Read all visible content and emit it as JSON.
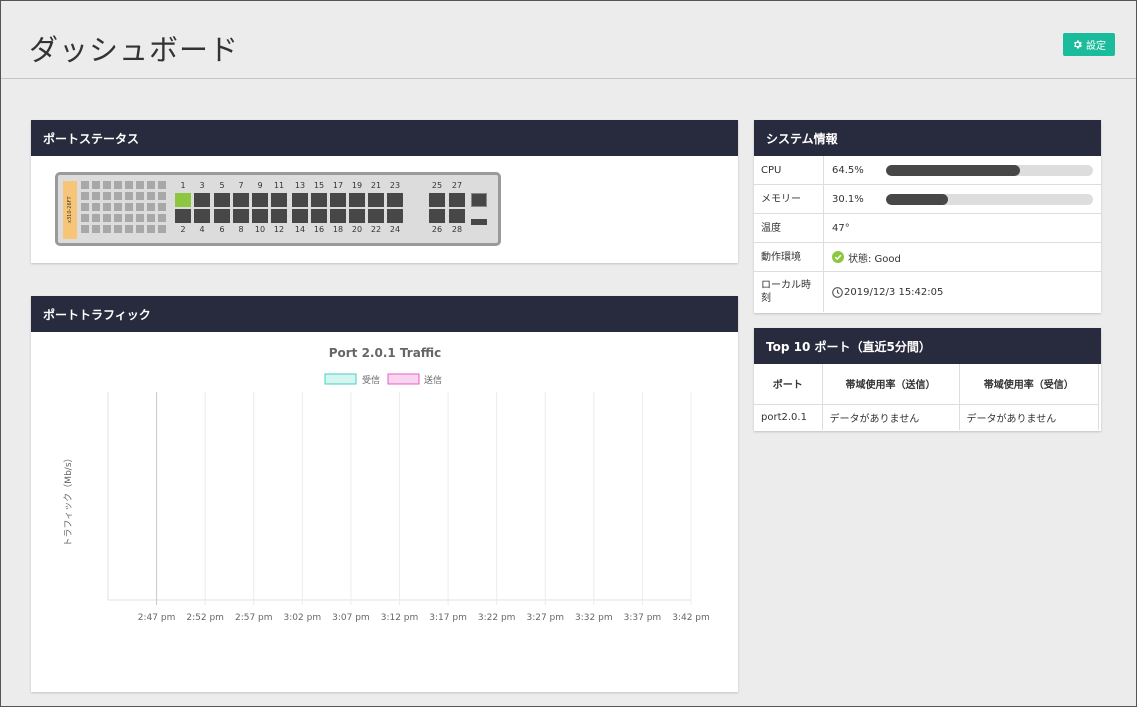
{
  "header": {
    "title": "ダッシュボード",
    "settings_label": "設定"
  },
  "colors": {
    "accent": "#1abc9c",
    "panel_header": "#282a3e",
    "port_up": "#8dc63f",
    "port_down": "#474747",
    "switch_label": "#f6c578",
    "rx_series": "#3fd3c0",
    "tx_series": "#e860c8"
  },
  "port_status": {
    "title": "ポートステータス",
    "switch_model": "x310-26FT",
    "odd_ports": [
      "1",
      "3",
      "5",
      "7",
      "9",
      "11",
      "13",
      "15",
      "17",
      "19",
      "21",
      "23"
    ],
    "even_ports": [
      "2",
      "4",
      "6",
      "8",
      "10",
      "12",
      "14",
      "16",
      "18",
      "20",
      "22",
      "24"
    ],
    "uplink_top": [
      "25",
      "27"
    ],
    "uplink_bottom": [
      "26",
      "28"
    ],
    "ports_up": [
      "1"
    ]
  },
  "port_traffic": {
    "title": "ポートトラフィック"
  },
  "chart_data": {
    "type": "line",
    "title": "Port 2.0.1 Traffic",
    "ylabel": "トラフィック（Mb/s）",
    "xlabel": "",
    "x": [
      "2:47 pm",
      "2:52 pm",
      "2:57 pm",
      "3:02 pm",
      "3:07 pm",
      "3:12 pm",
      "3:17 pm",
      "3:22 pm",
      "3:27 pm",
      "3:32 pm",
      "3:37 pm",
      "3:42 pm"
    ],
    "series": [
      {
        "name": "受信",
        "values": []
      },
      {
        "name": "送信",
        "values": []
      }
    ],
    "legend": "top",
    "grid": true
  },
  "system_info": {
    "title": "システム情報",
    "cpu_label": "CPU",
    "cpu_value": "64.5%",
    "cpu_fraction": 0.645,
    "memory_label": "メモリー",
    "memory_value": "30.1%",
    "memory_fraction": 0.301,
    "temp_label": "温度",
    "temp_value": "47°",
    "env_label": "動作環境",
    "env_value": "状態: Good",
    "time_label": "ローカル時刻",
    "time_value": "2019/12/3 15:42:05"
  },
  "top10": {
    "title": "Top 10 ポート（直近5分間）",
    "columns": [
      "ポート",
      "帯域使用率（送信）",
      "帯域使用率（受信）"
    ],
    "rows": [
      [
        "port2.0.1",
        "データがありません",
        "データがありません"
      ]
    ]
  }
}
